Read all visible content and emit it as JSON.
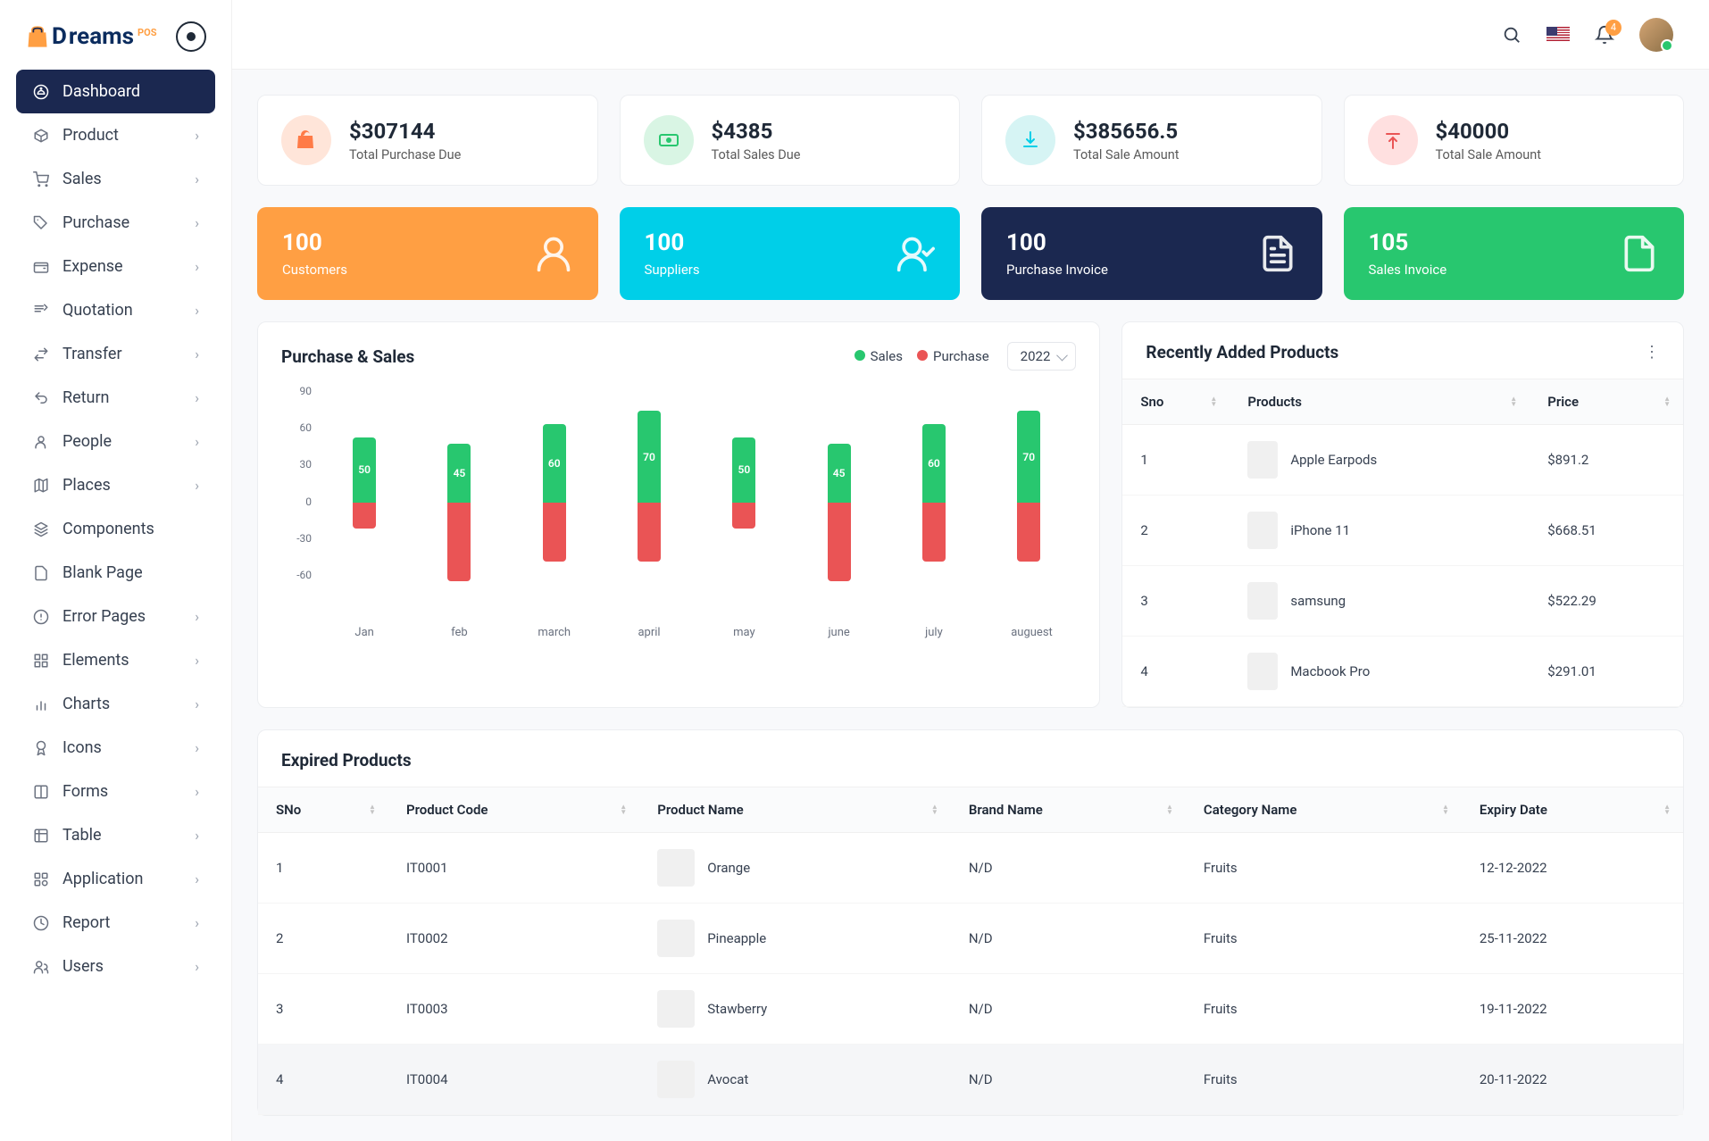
{
  "logo": {
    "text": "reams",
    "suffix": "POS"
  },
  "sidebar": {
    "items": [
      {
        "label": "Dashboard",
        "icon": "gauge",
        "chev": false,
        "active": true
      },
      {
        "label": "Product",
        "icon": "box",
        "chev": true
      },
      {
        "label": "Sales",
        "icon": "cart",
        "chev": true
      },
      {
        "label": "Purchase",
        "icon": "tag",
        "chev": true
      },
      {
        "label": "Expense",
        "icon": "wallet",
        "chev": true
      },
      {
        "label": "Quotation",
        "icon": "quote",
        "chev": true
      },
      {
        "label": "Transfer",
        "icon": "transfer",
        "chev": true
      },
      {
        "label": "Return",
        "icon": "return",
        "chev": true
      },
      {
        "label": "People",
        "icon": "user",
        "chev": true
      },
      {
        "label": "Places",
        "icon": "map",
        "chev": true
      },
      {
        "label": "Components",
        "icon": "layers",
        "chev": false
      },
      {
        "label": "Blank Page",
        "icon": "file",
        "chev": false
      },
      {
        "label": "Error Pages",
        "icon": "alert",
        "chev": true
      },
      {
        "label": "Elements",
        "icon": "grid",
        "chev": true
      },
      {
        "label": "Charts",
        "icon": "chart",
        "chev": true
      },
      {
        "label": "Icons",
        "icon": "award",
        "chev": true
      },
      {
        "label": "Forms",
        "icon": "columns",
        "chev": true
      },
      {
        "label": "Table",
        "icon": "table",
        "chev": true
      },
      {
        "label": "Application",
        "icon": "app",
        "chev": true
      },
      {
        "label": "Report",
        "icon": "clock",
        "chev": true
      },
      {
        "label": "Users",
        "icon": "users",
        "chev": true
      }
    ]
  },
  "topbar": {
    "notif_count": "4"
  },
  "stats": [
    {
      "value": "$307144",
      "label": "Total Purchase Due",
      "color": "orange"
    },
    {
      "value": "$4385",
      "label": "Total Sales Due",
      "color": "green"
    },
    {
      "value": "$385656.5",
      "label": "Total Sale Amount",
      "color": "cyan"
    },
    {
      "value": "$40000",
      "label": "Total Sale Amount",
      "color": "red"
    }
  ],
  "tiles": [
    {
      "value": "100",
      "label": "Customers",
      "color": "orange",
      "icon": "user"
    },
    {
      "value": "100",
      "label": "Suppliers",
      "color": "cyan",
      "icon": "user-check"
    },
    {
      "value": "100",
      "label": "Purchase Invoice",
      "color": "navy",
      "icon": "file-text"
    },
    {
      "value": "105",
      "label": "Sales Invoice",
      "color": "green",
      "icon": "file"
    }
  ],
  "chart": {
    "title": "Purchase & Sales",
    "legend": {
      "sales": "Sales",
      "purchase": "Purchase"
    },
    "year": "2022"
  },
  "chart_data": {
    "type": "bar",
    "title": "Purchase & Sales",
    "xlabel": "",
    "ylabel": "",
    "ylim": [
      -60,
      90
    ],
    "y_ticks": [
      "90",
      "60",
      "30",
      "0",
      "-30",
      "-60"
    ],
    "categories": [
      "Jan",
      "feb",
      "march",
      "april",
      "may",
      "june",
      "july",
      "auguest"
    ],
    "series": [
      {
        "name": "Sales",
        "color": "#28c76f",
        "values": [
          50,
          45,
          60,
          70,
          50,
          45,
          60,
          70
        ]
      },
      {
        "name": "Purchase",
        "color": "#ea5455",
        "values": [
          -20,
          -60,
          -45,
          -45,
          -20,
          -60,
          -45,
          -45
        ]
      }
    ]
  },
  "recent": {
    "title": "Recently Added Products",
    "headers": {
      "sno": "Sno",
      "products": "Products",
      "price": "Price"
    },
    "rows": [
      {
        "sno": "1",
        "name": "Apple Earpods",
        "price": "$891.2"
      },
      {
        "sno": "2",
        "name": "iPhone 11",
        "price": "$668.51"
      },
      {
        "sno": "3",
        "name": "samsung",
        "price": "$522.29"
      },
      {
        "sno": "4",
        "name": "Macbook Pro",
        "price": "$291.01",
        "blue": true
      }
    ]
  },
  "expired": {
    "title": "Expired Products",
    "headers": {
      "sno": "SNo",
      "code": "Product Code",
      "name": "Product Name",
      "brand": "Brand Name",
      "category": "Category Name",
      "expiry": "Expiry Date"
    },
    "rows": [
      {
        "sno": "1",
        "code": "IT0001",
        "name": "Orange",
        "brand": "N/D",
        "category": "Fruits",
        "expiry": "12-12-2022"
      },
      {
        "sno": "2",
        "code": "IT0002",
        "name": "Pineapple",
        "brand": "N/D",
        "category": "Fruits",
        "expiry": "25-11-2022"
      },
      {
        "sno": "3",
        "code": "IT0003",
        "name": "Stawberry",
        "brand": "N/D",
        "category": "Fruits",
        "expiry": "19-11-2022"
      },
      {
        "sno": "4",
        "code": "IT0004",
        "name": "Avocat",
        "brand": "N/D",
        "category": "Fruits",
        "expiry": "20-11-2022",
        "highlight": true
      }
    ]
  }
}
